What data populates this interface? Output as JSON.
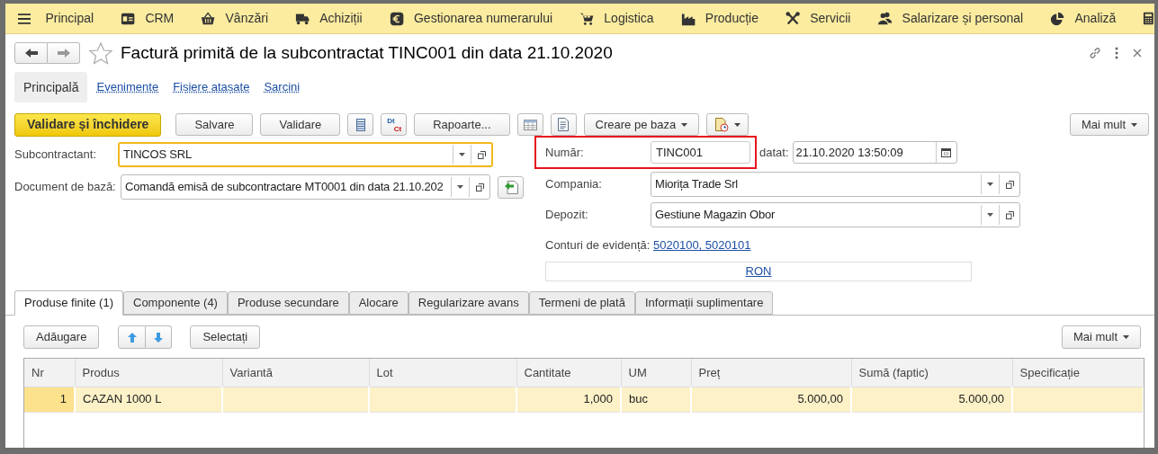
{
  "nav": [
    {
      "label": "Principal"
    },
    {
      "label": "CRM"
    },
    {
      "label": "Vânzări"
    },
    {
      "label": "Achiziții"
    },
    {
      "label": "Gestionarea numerarului"
    },
    {
      "label": "Logistica"
    },
    {
      "label": "Producție"
    },
    {
      "label": "Servicii"
    },
    {
      "label": "Salarizare și personal"
    },
    {
      "label": "Analiză"
    }
  ],
  "header": {
    "title": "Factură primită de la subcontractat TINC001 din data 21.10.2020",
    "favorite": false
  },
  "form_tabs": [
    {
      "label": "Principală",
      "selected": true
    },
    {
      "label": "Evenimente",
      "selected": false
    },
    {
      "label": "Fișiere atașate",
      "selected": false
    },
    {
      "label": "Sarcini",
      "selected": false
    }
  ],
  "toolbar": [
    {
      "kind": "primary",
      "label": "Validare și închidere"
    },
    {
      "kind": "button",
      "label": "Salvare"
    },
    {
      "kind": "button",
      "label": "Validare"
    },
    {
      "kind": "list-icon"
    },
    {
      "kind": "ledger",
      "top": "Dt",
      "bottom": "Ct"
    },
    {
      "kind": "button",
      "label": "Rapoarte..."
    },
    {
      "kind": "table-icon"
    },
    {
      "kind": "doc-icon"
    },
    {
      "kind": "dropdown",
      "label": "Creare pe baza"
    },
    {
      "kind": "icon-dropdown"
    }
  ],
  "toolbar_more": "Mai mult",
  "left_fields": [
    {
      "label": "Subcontractant:",
      "value": "TINCOS SRL",
      "focused": true,
      "action": false
    },
    {
      "label": "Document de bază:",
      "value": "Comandă emisă de subcontractare MT0001 din data 21.10.202",
      "focused": false,
      "action": true
    }
  ],
  "number": {
    "label": "Număr:",
    "value": "TINC001",
    "annotated": true,
    "date_label": "datat:",
    "date": "21.10.2020 13:50:09"
  },
  "right_fields": [
    {
      "label": "Compania:",
      "value": "Miorița Trade Srl"
    },
    {
      "label": "Depozit:",
      "value": "Gestiune Magazin Obor"
    }
  ],
  "accounts": {
    "label": "Conturi de evidență:",
    "link": "5020100, 5020101"
  },
  "currency": "RON",
  "tabs": [
    {
      "label": "Produse finite (1)",
      "selected": true
    },
    {
      "label": "Componente (4)",
      "selected": false
    },
    {
      "label": "Produse secundare",
      "selected": false
    },
    {
      "label": "Alocare",
      "selected": false
    },
    {
      "label": "Regularizare avans",
      "selected": false
    },
    {
      "label": "Termeni de plată",
      "selected": false
    },
    {
      "label": "Informații suplimentare",
      "selected": false
    }
  ],
  "table_toolbar": {
    "add": "Adăugare",
    "select": "Selectați",
    "more": "Mai mult"
  },
  "table": {
    "columns": [
      {
        "label": "Nr",
        "kind": "number"
      },
      {
        "label": "Produs",
        "kind": "text"
      },
      {
        "label": "Variantă",
        "kind": "text"
      },
      {
        "label": "Lot",
        "kind": "text"
      },
      {
        "label": "Cantitate",
        "kind": "number"
      },
      {
        "label": "UM",
        "kind": "text"
      },
      {
        "label": "Preț",
        "kind": "number"
      },
      {
        "label": "Sumă (faptic)",
        "kind": "number"
      },
      {
        "label": "Specificație",
        "kind": "text"
      }
    ],
    "rows": [
      {
        "selected": true,
        "cells": [
          "1",
          "CAZAN 1000 L",
          "",
          "",
          "1,000",
          "buc",
          "5.000,00",
          "5.000,00",
          ""
        ]
      }
    ]
  }
}
